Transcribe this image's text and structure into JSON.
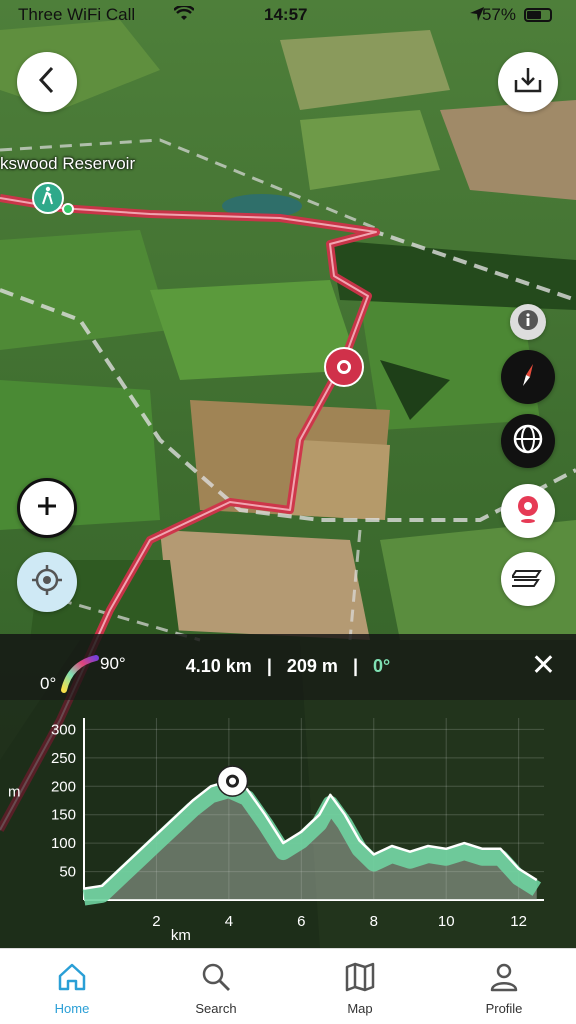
{
  "status_bar": {
    "carrier": "Three WiFi Call",
    "time": "14:57",
    "battery": "57%"
  },
  "map": {
    "place_label": "kswood Reservoir",
    "icons": {
      "back": "chevron-left-icon",
      "download": "download-icon",
      "info": "info-icon",
      "compass": "compass-icon",
      "globe": "globe-icon",
      "record": "location-pin-icon",
      "layers": "layers-icon",
      "zoom_in": "plus-icon",
      "locate": "locate-icon",
      "hiker": "hiker-icon"
    },
    "route_color": "#d0314a"
  },
  "profile": {
    "grade_min": "0°",
    "grade_max": "90°",
    "distance": "4.10 km",
    "elevation": "209 m",
    "slope": "0°",
    "separator": "|",
    "close_label": "✕"
  },
  "chart_data": {
    "type": "area",
    "xlabel": "km",
    "ylabel": "m",
    "x_ticks": [
      2,
      4,
      6,
      8,
      10,
      12
    ],
    "y_ticks": [
      50,
      100,
      150,
      200,
      250,
      300
    ],
    "xlim": [
      0,
      12.7
    ],
    "ylim": [
      0,
      320
    ],
    "series": [
      {
        "x": [
          0,
          0.5,
          1,
          1.5,
          2,
          2.5,
          3,
          3.5,
          4,
          4.5,
          5,
          5.5,
          6,
          6.5,
          6.8,
          7.2,
          7.6,
          8,
          8.5,
          9,
          9.5,
          10,
          10.5,
          11,
          11.5,
          12,
          12.5
        ],
        "y": [
          20,
          25,
          55,
          85,
          115,
          145,
          175,
          200,
          209,
          195,
          150,
          100,
          120,
          150,
          185,
          150,
          105,
          80,
          95,
          85,
          95,
          90,
          100,
          90,
          90,
          55,
          35
        ]
      }
    ],
    "marker": {
      "x": 4.1,
      "y": 209
    }
  },
  "tabs": [
    {
      "label": "Home",
      "icon": "home-icon",
      "active": true
    },
    {
      "label": "Search",
      "icon": "search-icon",
      "active": false
    },
    {
      "label": "Map",
      "icon": "map-icon",
      "active": false
    },
    {
      "label": "Profile",
      "icon": "profile-icon",
      "active": false
    }
  ]
}
